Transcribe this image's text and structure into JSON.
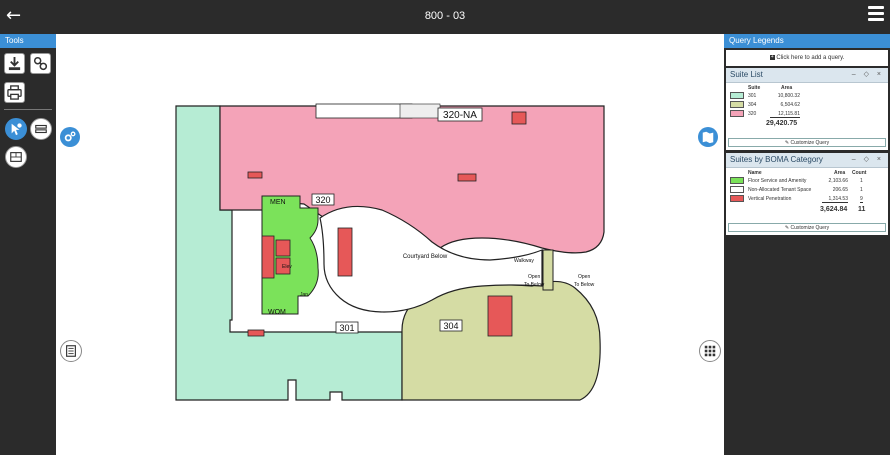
{
  "header": {
    "title": "800 - 03"
  },
  "tools": {
    "label": "Tools"
  },
  "floorplan": {
    "labels": {
      "suite_320_na": "320-NA",
      "suite_320": "320",
      "suite_301": "301",
      "suite_304": "304",
      "men": "MEN",
      "wom": "WOM",
      "elev": "Elev",
      "jan": "Jan",
      "courtyard": "Courtyard Below",
      "walkway": "Walkway",
      "open1": "Open",
      "open1b": "To Below",
      "open2": "Open",
      "open2b": "To Below"
    },
    "colors": {
      "pink": "#f4a3b8",
      "mint": "#b6ecd4",
      "olive": "#d5dca4",
      "green": "#7be25a",
      "red": "#e65858"
    }
  },
  "legends": {
    "title": "Query Legends",
    "add_query": "Click here to add a query.",
    "suite_list": {
      "title": "Suite List",
      "col_suite": "Suite",
      "col_area": "Area",
      "rows": [
        {
          "suite": "301",
          "area": "10,800.32",
          "color": "#b6ecd4"
        },
        {
          "suite": "304",
          "area": "6,504.62",
          "color": "#d5dca4"
        },
        {
          "suite": "320",
          "area": "12,115.81",
          "color": "#f4a3b8"
        }
      ],
      "total": "29,420.75",
      "customize": "Customize Query"
    },
    "boma": {
      "title": "Suites by BOMA Category",
      "col_name": "Name",
      "col_area": "Area",
      "col_count": "Count",
      "rows": [
        {
          "name": "Floor Service and Amenity",
          "area": "2,103.66",
          "count": "1",
          "color": "#7be25a"
        },
        {
          "name": "Non-Allocated Tenant Space",
          "area": "206.65",
          "count": "1",
          "color": "#ffffff"
        },
        {
          "name": "Vertical Penetration",
          "area": "1,314.53",
          "count": "9",
          "color": "#e65858"
        }
      ],
      "total_area": "3,624.84",
      "total_count": "11",
      "customize": "Customize Query"
    },
    "panel_controls": "– ◇ ×"
  }
}
